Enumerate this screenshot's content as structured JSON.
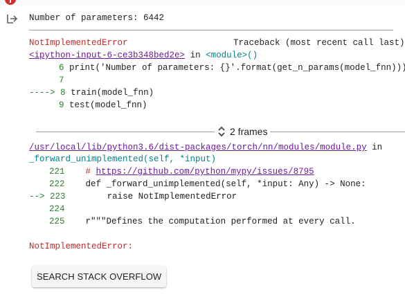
{
  "output": {
    "params_line": "Number of parameters: 6442"
  },
  "traceback": {
    "error_name": "NotImplementedError",
    "header_right": "Traceback (most recent call last)",
    "input_ref": "<ipython-input-6-ce3b348bed2e>",
    "in_word": "in",
    "module_ref": "<module>()",
    "lines": [
      {
        "num": "6",
        "code": "print('Number of parameters: {}'.format(get_n_params(model_fnn)))"
      },
      {
        "num": "7",
        "code": ""
      },
      {
        "num": "8",
        "code": "train(model_fnn)",
        "arrow": "---->"
      },
      {
        "num": "9",
        "code": "test(model_fnn)"
      }
    ],
    "frames_label": "2 frames",
    "module_path": "/usr/local/lib/python3.6/dist-packages/torch/nn/modules/module.py",
    "in_word2": "in",
    "func_ref": "_forward_unimplemented(self, *input)",
    "lines2": [
      {
        "num": "221",
        "prefix": "# ",
        "code": "https://github.com/python/mypy/issues/8795"
      },
      {
        "num": "222",
        "code": "def _forward_unimplemented(self, *input: Any) -> None:"
      },
      {
        "num": "223",
        "code": "raise NotImplementedError",
        "arrow": "-->"
      },
      {
        "num": "224",
        "code": ""
      },
      {
        "num": "225",
        "code": "r\"\"\"Defines the computation performed at every call."
      }
    ],
    "final_error": "NotImplementedError:"
  },
  "buttons": {
    "search_stack_overflow": "SEARCH STACK OVERFLOW"
  },
  "colors": {
    "error": "#c62828",
    "link": "#6a1b9a",
    "accent": "#00838f",
    "arrow": "#2e7d32"
  }
}
